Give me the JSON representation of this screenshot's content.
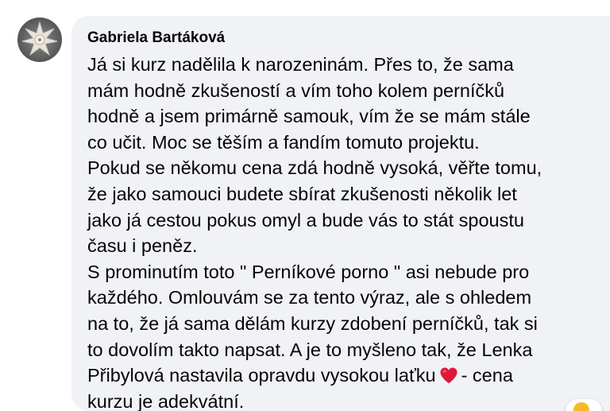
{
  "comment": {
    "author": "Gabriela Bartáková",
    "avatar_icon": "gingerbread-star-avatar",
    "lines_before_heart": [
      "Já si kurz nadělila k narozeninám. Přes to, že sama",
      "mám hodně zkušeností a vím toho kolem perníčků",
      "hodně a jsem primárně samouk, vím že se mám stále",
      "co učit. Moc se těším a fandím tomuto projektu.",
      "Pokud se někomu cena zdá hodně vysoká, věřte tomu,",
      "že jako samouci budete sbírat zkušenosti několik let",
      "jako já cestou pokus omyl a bude vás to stát spoustu",
      "času i peněz.",
      "S prominutím toto \" Perníkové porno \" asi nebude pro",
      "každého. Omlouvám se za tento výraz, ale s ohledem",
      "na to, že já sama dělám kurzy zdobení perníčků, tak si",
      "to dovolím takto napsat. A je to myšleno tak, že Lenka"
    ],
    "heart_line_prefix": "Přibylová nastavila opravdu vysokou laťku",
    "heart_emoji": "❤️",
    "heart_line_suffix": "- cena",
    "last_line": "kurzu je adekvátní.",
    "heart_color": "#e0173d",
    "bubble_color": "#f0f2f5"
  }
}
